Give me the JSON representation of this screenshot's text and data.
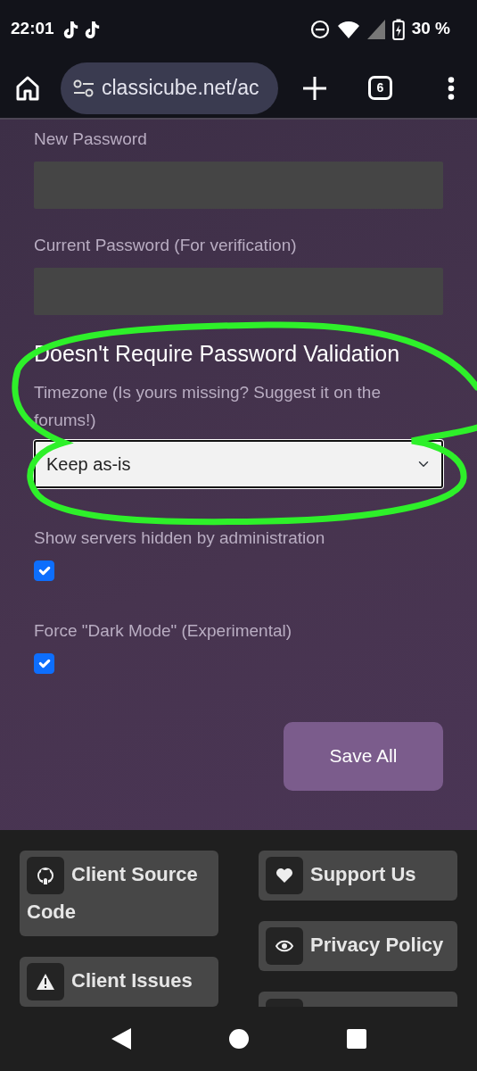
{
  "status_bar": {
    "time": "22:01",
    "battery": "30 %"
  },
  "browser": {
    "url": "classicube.net/ac",
    "tab_count": "6"
  },
  "form": {
    "fields": [
      {
        "label": "New Password"
      },
      {
        "label": "Current Password (For verification)"
      }
    ],
    "section_heading": "Doesn't Require Password Validation",
    "timezone": {
      "label": "Timezone (Is yours missing? Suggest it on the forums!)",
      "value": "Keep as-is"
    },
    "checkboxes": [
      {
        "label": "Show servers hidden by administration",
        "checked": true
      },
      {
        "label": "Force \"Dark Mode\" (Experimental)",
        "checked": true
      }
    ],
    "save_button": "Save All"
  },
  "footer": {
    "columns": [
      [
        {
          "label": "Client Source Code"
        },
        {
          "label": "Client Issues"
        }
      ],
      [
        {
          "label": "Support Us"
        },
        {
          "label": "Privacy Policy"
        }
      ]
    ]
  }
}
